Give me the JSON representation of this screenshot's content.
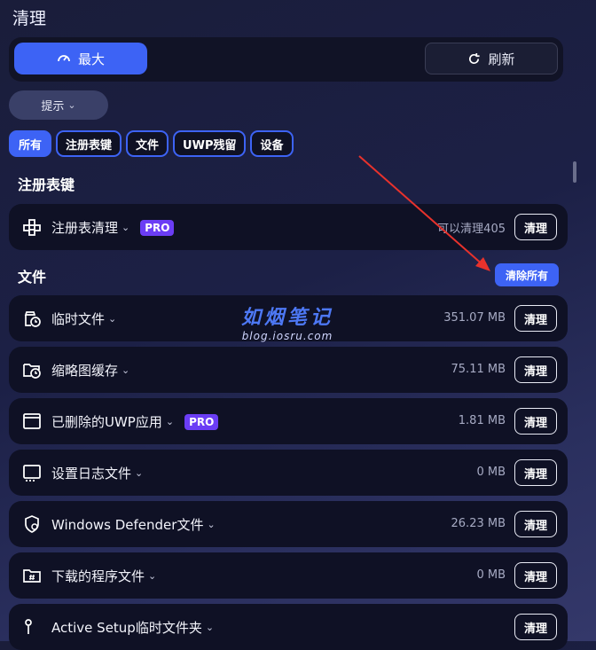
{
  "title": "清理",
  "modes": {
    "max_label": "最大",
    "refresh_label": "刷新"
  },
  "hint_label": "提示",
  "filters": [
    "所有",
    "注册表键",
    "文件",
    "UWP残留",
    "设备"
  ],
  "sections": {
    "registry": "注册表键",
    "files": "文件"
  },
  "clear_all_label": "清除所有",
  "clean_label": "清理",
  "pro_label": "PRO",
  "registry_item": {
    "name": "注册表清理",
    "status": "可以清理405"
  },
  "file_items": [
    {
      "name": "临时文件",
      "size": "351.07 MB"
    },
    {
      "name": "缩略图缓存",
      "size": "75.11 MB"
    },
    {
      "name": "已删除的UWP应用",
      "size": "1.81 MB"
    },
    {
      "name": "设置日志文件",
      "size": "0 MB"
    },
    {
      "name": "Windows Defender文件",
      "size": "26.23 MB"
    },
    {
      "name": "下载的程序文件",
      "size": "0 MB"
    },
    {
      "name": "Active Setup临时文件夹",
      "size": ""
    }
  ],
  "watermark": {
    "cn": "如烟笔记",
    "url": "blog.iosru.com"
  },
  "colors": {
    "accent": "#3d63f5",
    "pro": "#6b3df5",
    "arrow": "#e8322c"
  }
}
